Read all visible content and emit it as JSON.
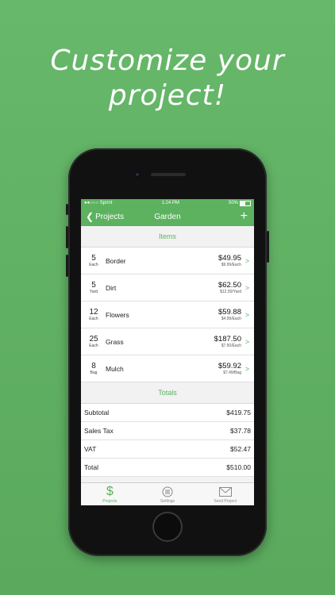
{
  "headline": {
    "line1": "Customize your",
    "line2": "project!"
  },
  "status_bar": {
    "carrier": "●●○○○ Sprint",
    "time": "1:24 PM",
    "battery": "50%"
  },
  "nav": {
    "back_label": "Projects",
    "title": "Garden",
    "add_label": "+"
  },
  "items_header": "Items",
  "items": [
    {
      "qty": "5",
      "unit": "Each",
      "name": "Border",
      "price": "$49.95",
      "each": "$9.99/Each"
    },
    {
      "qty": "5",
      "unit": "Yard",
      "name": "Dirt",
      "price": "$62.50",
      "each": "$12.50/Yard"
    },
    {
      "qty": "12",
      "unit": "Each",
      "name": "Flowers",
      "price": "$59.88",
      "each": "$4.99/Each"
    },
    {
      "qty": "25",
      "unit": "Each",
      "name": "Grass",
      "price": "$187.50",
      "each": "$7.50/Each"
    },
    {
      "qty": "8",
      "unit": "Bag",
      "name": "Mulch",
      "price": "$59.92",
      "each": "$7.49/Bag"
    }
  ],
  "totals_header": "Totals",
  "totals": [
    {
      "label": "Subtotal",
      "value": "$419.75"
    },
    {
      "label": "Sales Tax",
      "value": "$37.78"
    },
    {
      "label": "VAT",
      "value": "$52.47"
    },
    {
      "label": "Total",
      "value": "$510.00"
    }
  ],
  "tabs": [
    {
      "label": "Projects",
      "icon": "dollar-icon",
      "active": true
    },
    {
      "label": "Settings",
      "icon": "settings-icon",
      "active": false
    },
    {
      "label": "Send Project",
      "icon": "envelope-icon",
      "active": false
    }
  ],
  "colors": {
    "accent": "#5cb25f",
    "background": "#62b365"
  }
}
